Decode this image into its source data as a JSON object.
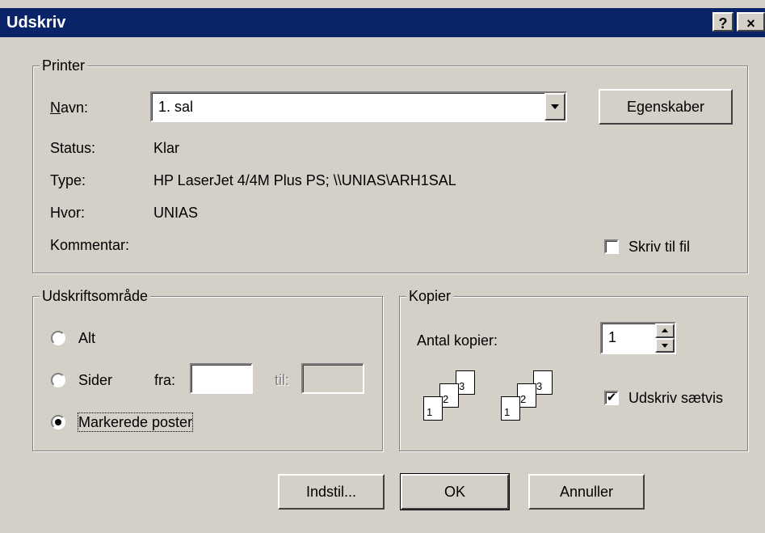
{
  "window": {
    "title": "Udskriv",
    "help_glyph": "?",
    "close_glyph": "×"
  },
  "printer": {
    "legend": "Printer",
    "name_label": "Navn:",
    "name_value": "1. sal",
    "properties_button": "Egenskaber",
    "status_label": "Status:",
    "status_value": "Klar",
    "type_label": "Type:",
    "type_value": "HP LaserJet 4/4M Plus PS; \\\\UNIAS\\ARH1SAL",
    "where_label": "Hvor:",
    "where_value": "UNIAS",
    "comment_label": "Kommentar:",
    "comment_value": "",
    "print_to_file_label": "Skriv til fil",
    "print_to_file_checked": false
  },
  "range": {
    "legend": "Udskriftsområde",
    "all_label": "Alt",
    "pages_label": "Sider",
    "from_label": "fra:",
    "from_value": "",
    "to_label": "til:",
    "to_value": "",
    "selection_label": "Markerede poster",
    "selected": "selection"
  },
  "copies": {
    "legend": "Kopier",
    "count_label": "Antal kopier:",
    "count_value": "1",
    "collate_label": "Udskriv sætvis",
    "collate_checked": true,
    "page_numbers": [
      "1",
      "2",
      "3"
    ]
  },
  "buttons": {
    "setup": "Indstil...",
    "ok": "OK",
    "cancel": "Annuller"
  }
}
